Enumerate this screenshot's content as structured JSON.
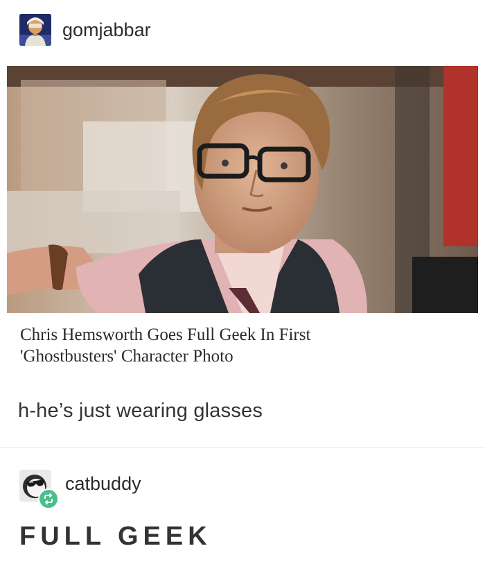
{
  "post": {
    "author": "gomjabbar",
    "link": {
      "headline_line1": "Chris Hemsworth Goes Full Geek In First",
      "headline_line2": "'Ghostbusters' Character Photo"
    },
    "caption": "h-he’s just wearing glasses"
  },
  "reblog": {
    "author": "catbuddy",
    "text": "FULL GEEK"
  },
  "icons": [
    "avatar-gomjabbar",
    "avatar-catbuddy-sunglasses",
    "reblog-icon"
  ],
  "colors": {
    "reblog_badge": "#4bbf8b",
    "divider": "#e6e6e6",
    "text": "#333333"
  }
}
